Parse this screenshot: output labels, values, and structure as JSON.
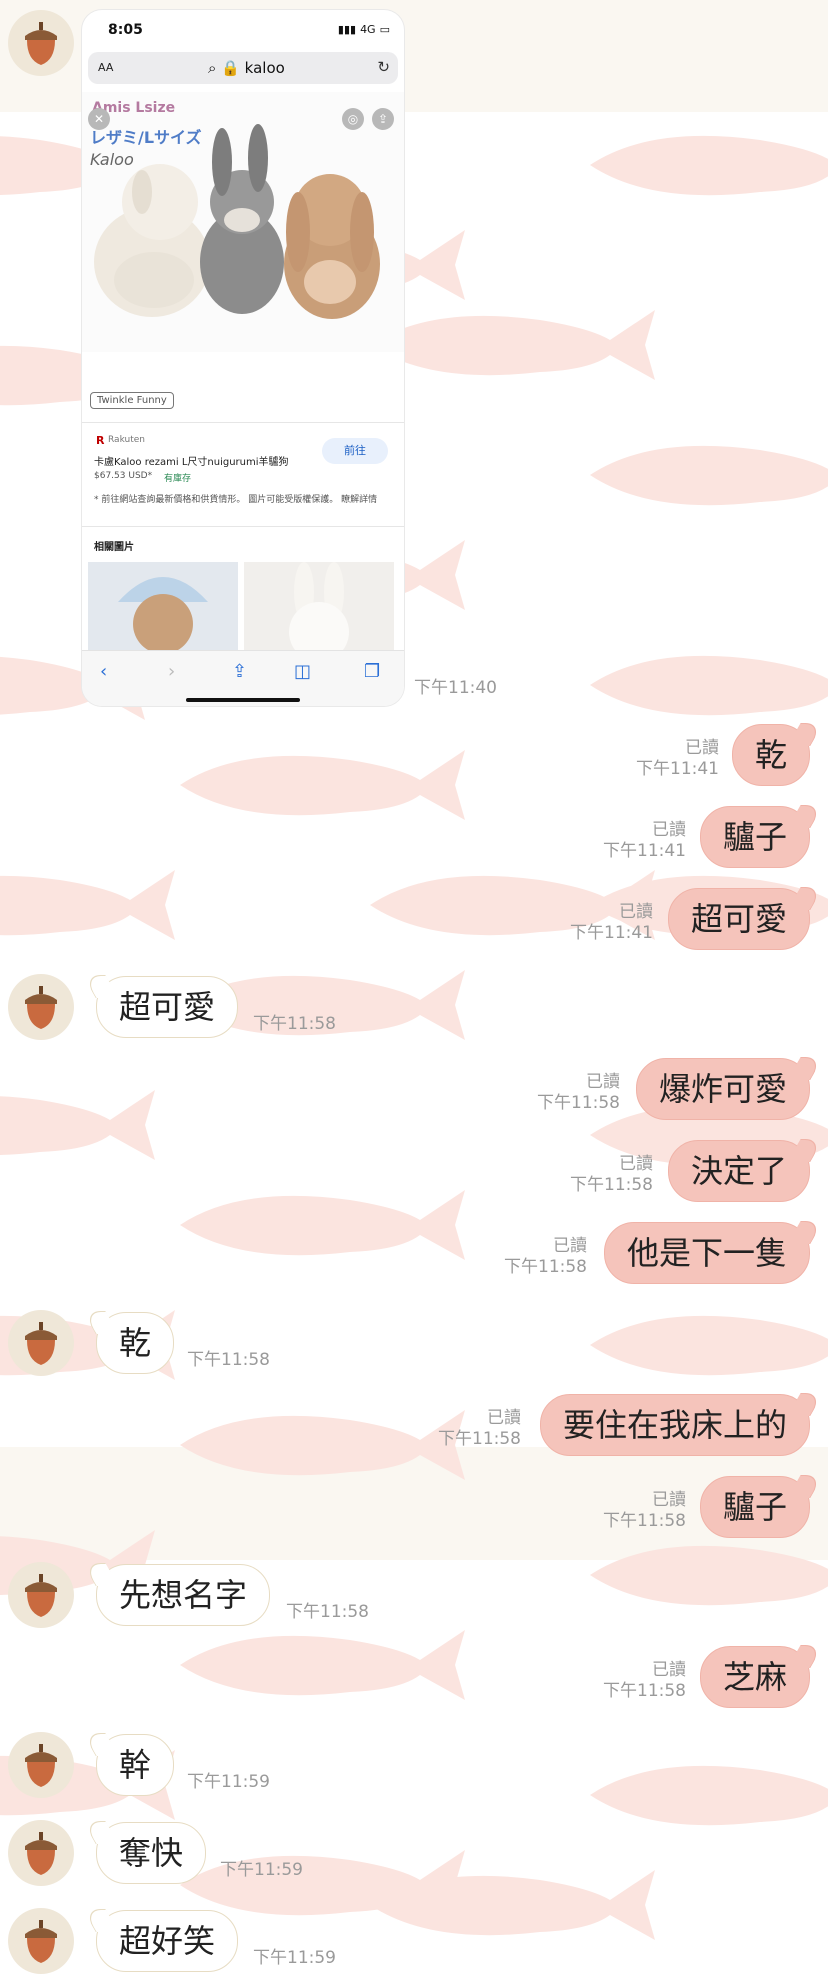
{
  "screenshot": {
    "status_time": "8:05",
    "network": "4G",
    "url_aa": "AA",
    "url": "kaloo",
    "image_brand": "Amis Lsize",
    "image_jp": "レザミ/Lサイズ",
    "image_kaloo": "Kaloo",
    "twinkle": "Twinkle Funny",
    "seller": "Rakuten",
    "product_title": "卡盧Kaloo rezami L尺寸nuigurumi羊驢狗",
    "price": "$67.53 USD*",
    "stock": "有庫存",
    "go_button": "前往",
    "note": "* 前往網站查詢最新價格和供貨情形。 圖片可能受版權保護。 瞭解詳情",
    "related": "相關圖片",
    "sent_time": "下午11:40"
  },
  "read_label": "已讀",
  "messages": [
    {
      "dir": "out",
      "text": "乾",
      "time": "下午11:41"
    },
    {
      "dir": "out",
      "text": "驢子",
      "time": "下午11:41"
    },
    {
      "dir": "out",
      "text": "超可愛",
      "time": "下午11:41"
    },
    {
      "dir": "in",
      "text": "超可愛",
      "time": "下午11:58"
    },
    {
      "dir": "out",
      "text": "爆炸可愛",
      "time": "下午11:58"
    },
    {
      "dir": "out",
      "text": "決定了",
      "time": "下午11:58"
    },
    {
      "dir": "out",
      "text": "他是下一隻",
      "time": "下午11:58"
    },
    {
      "dir": "in",
      "text": "乾",
      "time": "下午11:58"
    },
    {
      "dir": "out",
      "text": "要住在我床上的",
      "time": "下午11:58"
    },
    {
      "dir": "out",
      "text": "驢子",
      "time": "下午11:58"
    },
    {
      "dir": "in",
      "text": "先想名字",
      "time": "下午11:58"
    },
    {
      "dir": "out",
      "text": "芝麻",
      "time": "下午11:58"
    },
    {
      "dir": "in",
      "text": "幹",
      "time": "下午11:59"
    },
    {
      "dir": "in",
      "text": "奪快",
      "time": "下午11:59"
    },
    {
      "dir": "in",
      "text": "超好笑",
      "time": "下午11:59"
    }
  ],
  "colors": {
    "out_bubble": "#f5c4bb",
    "in_bubble": "#ffffff",
    "fish": "#fbe4df",
    "avatar_bg": "#efe7d8",
    "acorn": "#c96a3f"
  },
  "icons": [
    "acorn-avatar-icon",
    "search-icon",
    "lock-icon",
    "reload-icon",
    "back-icon",
    "forward-icon",
    "share-icon",
    "bookmarks-icon",
    "tabs-icon",
    "close-icon",
    "scan-icon"
  ]
}
